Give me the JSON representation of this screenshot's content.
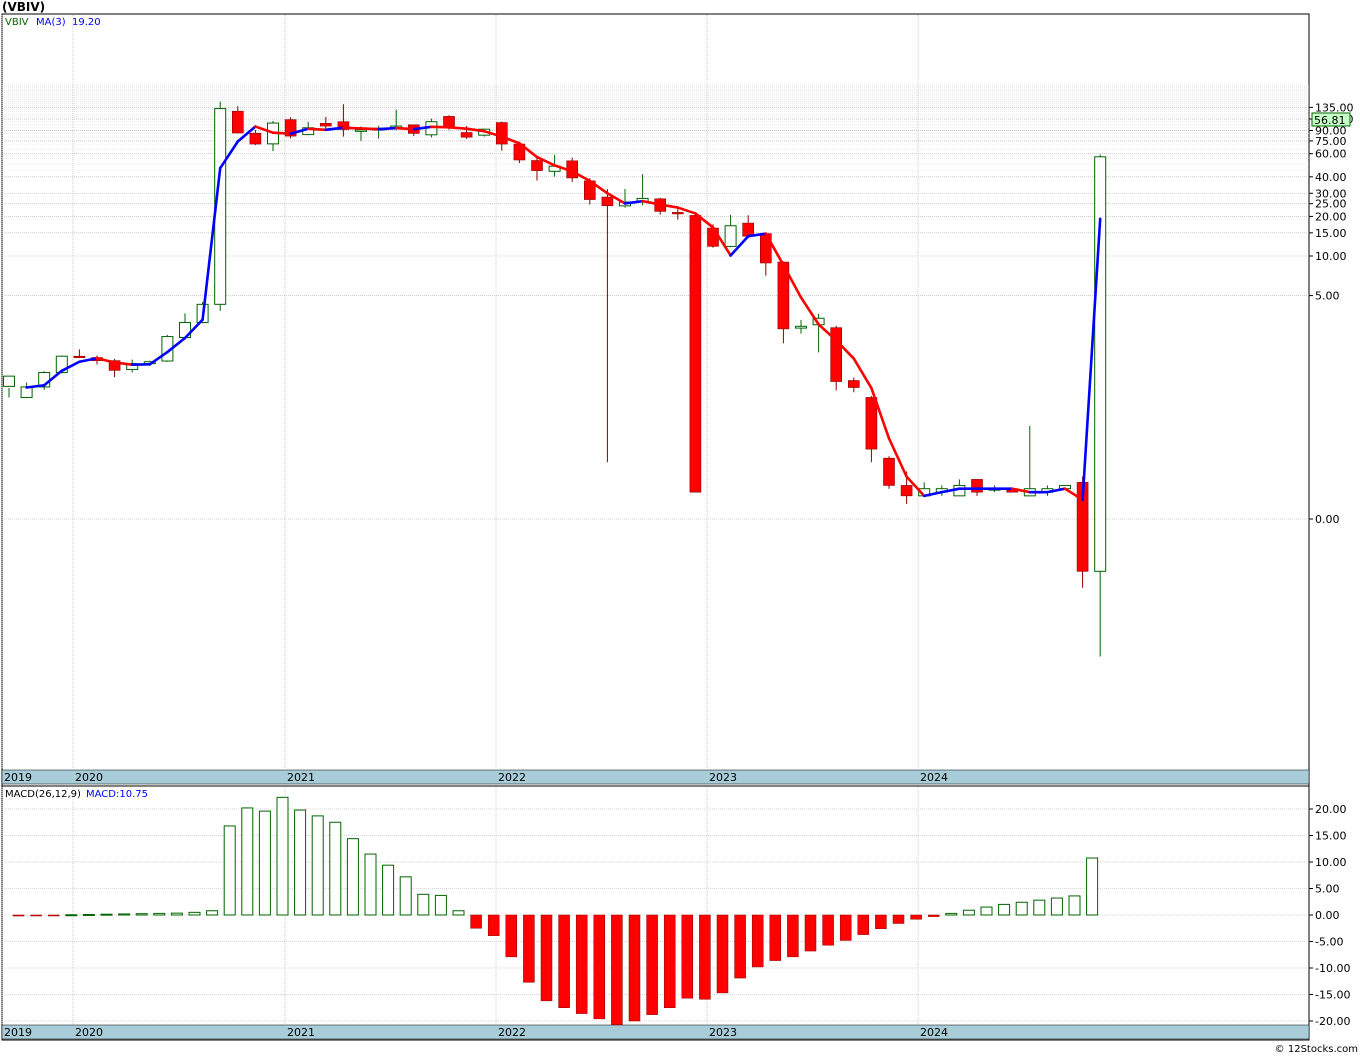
{
  "title": "(VBIV)",
  "watermark": "© 12Stocks.com",
  "colors": {
    "up": "#006400",
    "down": "#ff0000",
    "ma_up": "#0000ff",
    "ma_down": "#ff0000",
    "grid": "#c0c0c0",
    "axis_band": "#a8cdd9",
    "last_price_box": "#c8ffc8"
  },
  "price_panel": {
    "legend": {
      "symbol": "VBIV",
      "ma_label": "MA(3)",
      "ma_value": "19.20"
    },
    "last_price": "56.81",
    "y_tick_labels": [
      "135.00",
      "110.00",
      "90.00",
      "75.00",
      "60.00",
      "40.00",
      "30.00",
      "25.00",
      "20.00",
      "15.00",
      "10.00",
      "5.00",
      "0.00"
    ],
    "x_labels": [
      "2019",
      "2020",
      "2021",
      "2022",
      "2023",
      "2024"
    ]
  },
  "macd_panel": {
    "legend": {
      "label": "MACD(26,12,9)",
      "value_label": "MACD:10.75"
    },
    "y_tick_labels": [
      "20.00",
      "15.00",
      "10.00",
      "5.00",
      "0.00",
      "-5.00",
      "-10.00",
      "-15.00",
      "-20.00"
    ],
    "x_labels": [
      "2019",
      "2020",
      "2021",
      "2022",
      "2023",
      "2024"
    ]
  },
  "chart_data": [
    {
      "type": "candlestick",
      "title": "(VBIV)",
      "frequency": "monthly",
      "y_scale": "log",
      "price_ticks": [
        135,
        110,
        90,
        75,
        60,
        40,
        30,
        25,
        20,
        15,
        10,
        5
      ],
      "start_month": "2019-01",
      "candles": [
        [
          1.02,
          1.22,
          0.99,
          0.84
        ],
        [
          0.84,
          1.01,
          1.09,
          0.83
        ],
        [
          1.01,
          1.3,
          1.33,
          0.96
        ],
        [
          1.3,
          1.73,
          1.75,
          1.28
        ],
        [
          1.73,
          1.69,
          1.95,
          1.67
        ],
        [
          1.69,
          1.6,
          1.75,
          1.5
        ],
        [
          1.6,
          1.35,
          1.65,
          1.2
        ],
        [
          1.37,
          1.52,
          1.63,
          1.3
        ],
        [
          1.52,
          1.57,
          1.6,
          1.47
        ],
        [
          1.59,
          2.44,
          2.51,
          1.57
        ],
        [
          2.4,
          3.12,
          3.66,
          2.31
        ],
        [
          3.12,
          4.29,
          4.47,
          3.07
        ],
        [
          4.29,
          132.21,
          149.41,
          3.83
        ],
        [
          126.16,
          86.22,
          137.89,
          85.52
        ],
        [
          85.89,
          71.04,
          91.0,
          69.73
        ],
        [
          71.26,
          102.56,
          106.42,
          62.72
        ],
        [
          108.87,
          81.65,
          113.5,
          78.35
        ],
        [
          83.78,
          94.43,
          104.85,
          83.1
        ],
        [
          102.03,
          97.31,
          114.13,
          92.75
        ],
        [
          104.99,
          91.58,
          142.69,
          80.84
        ],
        [
          90.04,
          91.04,
          96.77,
          75.18
        ],
        [
          90.75,
          93.61,
          98.02,
          78.09
        ],
        [
          95.19,
          97.31,
          129.66,
          90.75
        ],
        [
          99.44,
          85.6,
          99.68,
          81.76
        ],
        [
          83.5,
          104.99,
          110.93,
          79.79
        ],
        [
          115.2,
          94.43,
          117.52,
          91.23
        ],
        [
          86.89,
          80.08,
          97.51,
          77.63
        ],
        [
          82.94,
          92.09,
          92.97,
          80.84
        ],
        [
          103.48,
          71.04,
          105.27,
          63.15
        ],
        [
          71.04,
          53.72,
          74.12,
          50.85
        ],
        [
          53.22,
          44.61,
          56.54,
          37.39
        ],
        [
          44.05,
          48.19,
          58.77,
          40.2
        ],
        [
          52.9,
          39.23,
          55.99,
          36.54
        ],
        [
          37.26,
          26.88,
          39.05,
          24.61
        ],
        [
          28.06,
          24.12,
          32.22,
          0.27
        ],
        [
          24.06,
          25.74,
          32.32,
          23.35
        ],
        [
          26.0,
          27.4,
          41.94,
          24.26
        ],
        [
          27.21,
          21.84,
          27.73,
          20.61
        ],
        [
          21.45,
          21.07,
          23.22,
          18.91
        ],
        [
          20.34,
          0.16,
          20.73,
          0.16
        ],
        [
          16.3,
          11.84,
          17.39,
          11.58
        ],
        [
          11.83,
          16.98,
          20.56,
          11.65
        ],
        [
          17.79,
          14.14,
          20.4,
          13.61
        ],
        [
          14.8,
          8.85,
          14.92,
          7.09
        ],
        [
          8.99,
          2.79,
          9.09,
          2.17
        ],
        [
          2.83,
          2.92,
          3.26,
          2.57
        ],
        [
          3.0,
          3.36,
          3.64,
          1.85
        ],
        [
          2.85,
          1.11,
          2.95,
          0.95
        ],
        [
          1.13,
          1.0,
          1.19,
          0.92
        ],
        [
          0.84,
          0.34,
          0.86,
          0.27
        ],
        [
          0.29,
          0.18,
          0.3,
          0.17
        ],
        [
          0.18,
          0.15,
          0.23,
          0.13
        ],
        [
          0.15,
          0.17,
          0.19,
          0.16
        ],
        [
          0.16,
          0.17,
          0.18,
          0.15
        ],
        [
          0.15,
          0.18,
          0.2,
          0.15
        ],
        [
          0.2,
          0.16,
          0.2,
          0.15
        ],
        [
          0.17,
          0.17,
          0.18,
          0.16
        ],
        [
          0.17,
          0.16,
          0.17,
          0.16
        ],
        [
          0.15,
          0.17,
          0.51,
          0.15
        ],
        [
          0.16,
          0.17,
          0.18,
          0.15
        ],
        [
          0.17,
          0.18,
          0.18,
          0.17
        ],
        [
          0.19,
          0.04,
          0.21,
          0.03
        ],
        [
          0.04,
          56.81,
          59.13,
          0.009
        ]
      ],
      "ma3": [
        null,
        1.0,
        1.04,
        1.34,
        1.57,
        1.67,
        1.55,
        1.49,
        1.5,
        1.86,
        2.38,
        3.28,
        46.54,
        74.24,
        96.49,
        86.61,
        85.07,
        92.8,
        91.13,
        94.63,
        93.31,
        92.09,
        94.02,
        92.09,
        95.97,
        95.19,
        92.97,
        88.96,
        80.84,
        71.93,
        56.54,
        48.87,
        44.05,
        37.26,
        29.99,
        25.1,
        26.13,
        24.61,
        23.35,
        21.07,
        16.49,
        10.09,
        14.14,
        14.8,
        8.54,
        4.84,
        3.02,
        2.28,
        1.66,
        0.99,
        0.41,
        0.21,
        0.15,
        0.16,
        0.17,
        0.17,
        0.17,
        0.17,
        0.16,
        0.16,
        0.17,
        0.14,
        19.2
      ],
      "x_axis_labels": [
        "2019",
        "2020",
        "2021",
        "2022",
        "2023",
        "2024"
      ],
      "last_price": 56.81,
      "ma_label": "MA(3)",
      "ma_last_value": 19.2
    },
    {
      "type": "bar",
      "title": "MACD(26,12,9)",
      "ylim": [
        -20,
        22
      ],
      "y_ticks": [
        20,
        15,
        10,
        5,
        0,
        -5,
        -10,
        -15,
        -20
      ],
      "x_axis_labels": [
        "2019",
        "2020",
        "2021",
        "2022",
        "2023",
        "2024"
      ],
      "values": [
        -0.2,
        -0.15,
        -0.1,
        0.05,
        0.1,
        0.15,
        0.2,
        0.25,
        0.3,
        0.35,
        0.5,
        0.8,
        16.8,
        20.2,
        19.6,
        22.2,
        19.8,
        18.7,
        17.5,
        14.4,
        11.5,
        9.4,
        7.2,
        3.9,
        3.7,
        0.8,
        -2.5,
        -3.9,
        -7.9,
        -12.7,
        -16.2,
        -17.5,
        -18.6,
        -19.6,
        -20.7,
        -20.0,
        -18.8,
        -17.5,
        -15.7,
        -15.9,
        -14.7,
        -11.9,
        -9.8,
        -8.6,
        -7.9,
        -6.8,
        -5.7,
        -4.8,
        -3.7,
        -2.6,
        -1.6,
        -0.8,
        -0.3,
        0.3,
        0.9,
        1.5,
        2.0,
        2.4,
        2.8,
        3.2,
        3.6,
        10.75
      ],
      "colors_by_sign": {
        "positive": "#006400",
        "negative": "#ff0000"
      },
      "last_value_label": "MACD:10.75"
    }
  ]
}
